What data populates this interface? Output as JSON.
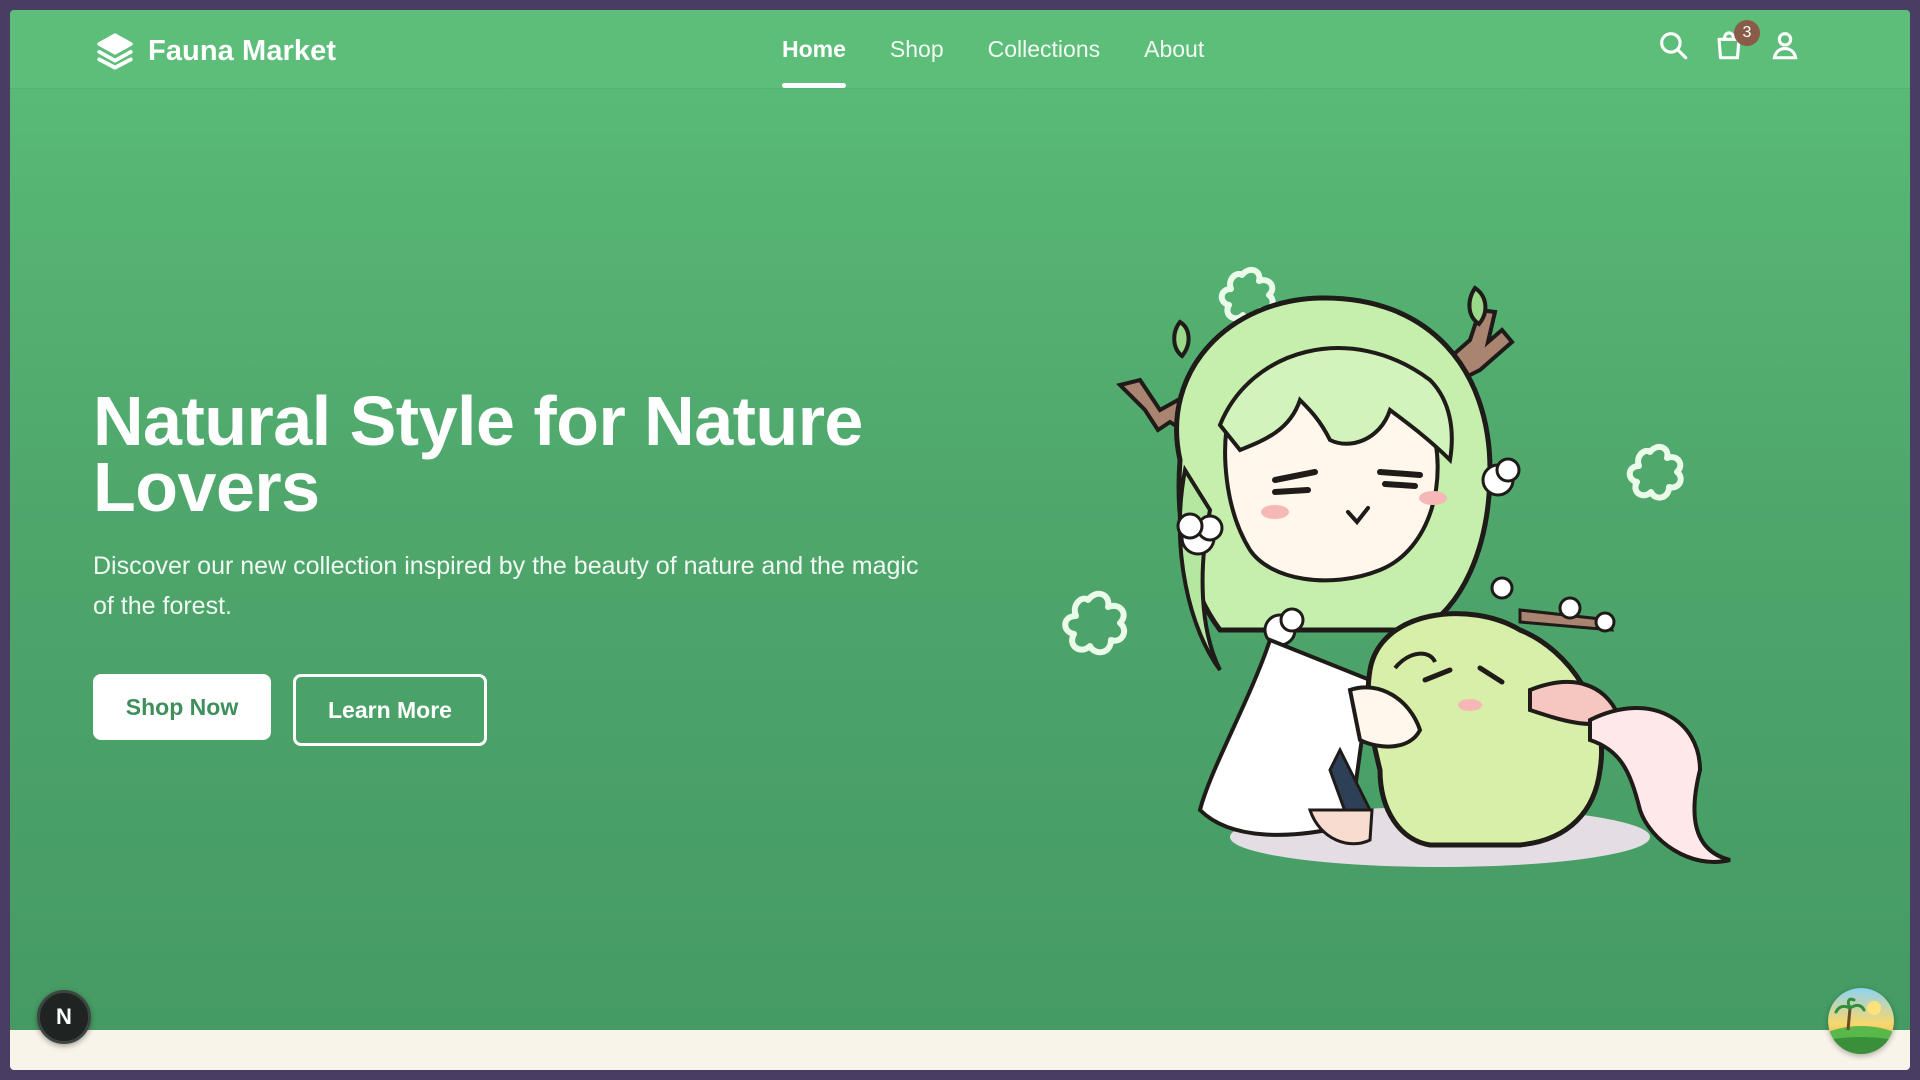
{
  "brand": {
    "name": "Fauna Market",
    "icon": "layers-icon"
  },
  "nav": {
    "links": [
      {
        "label": "Home",
        "active": true
      },
      {
        "label": "Shop",
        "active": false
      },
      {
        "label": "Collections",
        "active": false
      },
      {
        "label": "About",
        "active": false
      }
    ],
    "icons": [
      "search-icon",
      "shopping-bag-icon",
      "user-icon"
    ],
    "cart_count": "3"
  },
  "hero": {
    "title_line1": "Natural Style for Nature",
    "title_line2": "Lovers",
    "subtitle": "Discover our new collection inspired by the beauty of nature and the magic of the forest.",
    "primary_cta": "Shop Now",
    "secondary_cta": "Learn More"
  },
  "overlay": {
    "dev_badge": "N",
    "assistant_icon": "island-sunset-icon"
  },
  "colors": {
    "hero_top": "#5bbd78",
    "hero_bottom": "#449a63",
    "button_text": "#3f8f5c",
    "cart_badge": "#8a5b49",
    "bottom_strip": "#f8f4ea"
  }
}
